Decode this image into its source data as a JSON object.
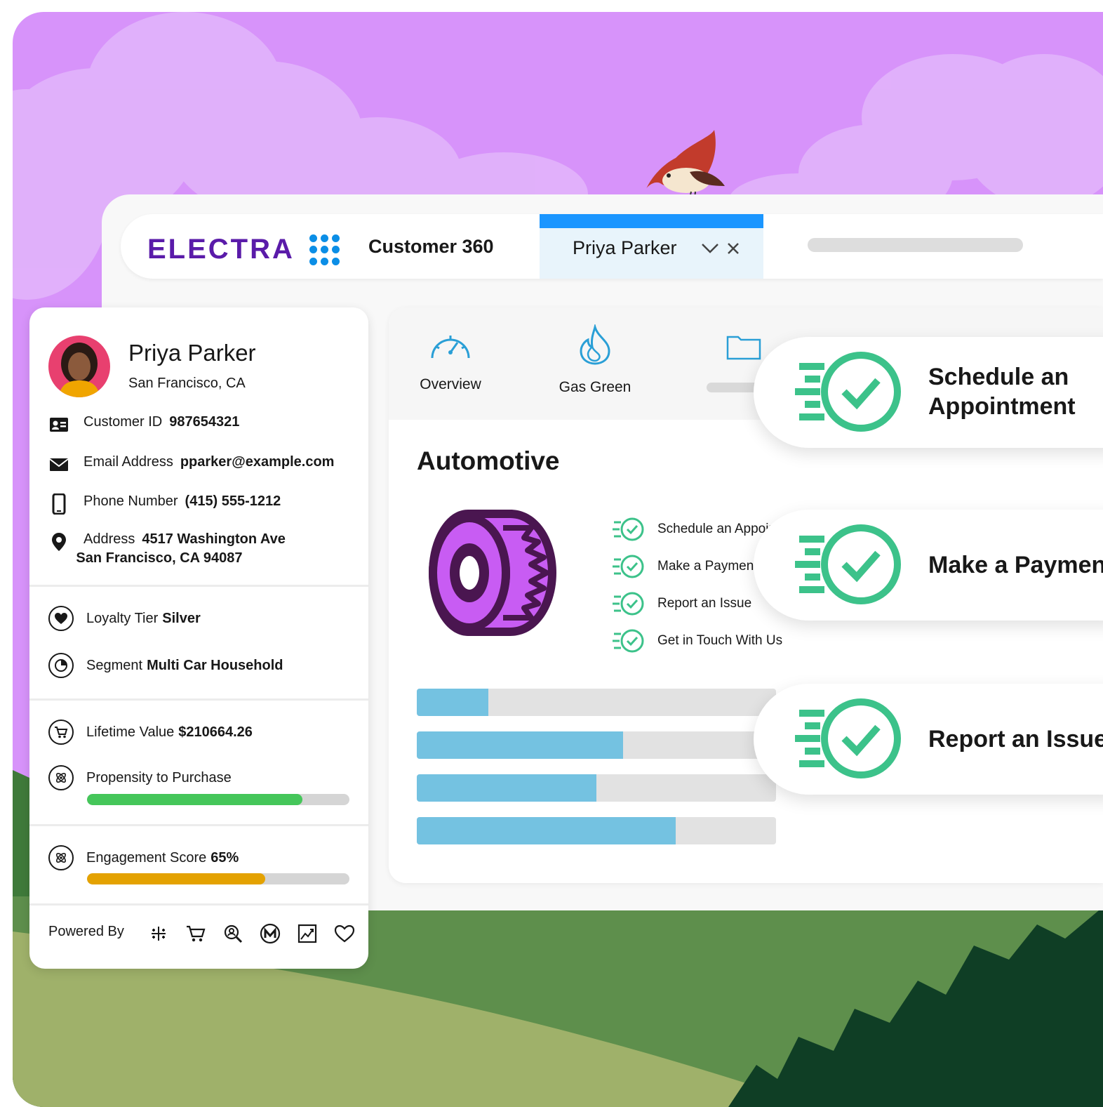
{
  "app": {
    "logo": "ELECTRA",
    "name": "Customer 360"
  },
  "tab": {
    "label": "Priya Parker",
    "accent": "#1B96FF"
  },
  "profile": {
    "name": "Priya Parker",
    "location": "San Francisco, CA",
    "fields": [
      {
        "label": "Customer ID",
        "value": "987654321",
        "icon": "id-card-icon"
      },
      {
        "label": "Email Address",
        "value": "pparker@example.com",
        "icon": "email-icon"
      },
      {
        "label": "Phone Number",
        "value": "(415) 555-1212",
        "icon": "phone-icon"
      },
      {
        "label": "Address",
        "value_line1": "4517 Washington Ave",
        "value_line2": "San Francisco, CA 94087",
        "icon": "location-pin-icon"
      }
    ],
    "loyalty": {
      "label": "Loyalty Tier",
      "value": "Silver"
    },
    "segment": {
      "label": "Segment",
      "value": "Multi Car Household"
    },
    "lifetime": {
      "label": "Lifetime Value",
      "value": "$210664.26"
    },
    "propensity": {
      "label": "Propensity to Purchase",
      "level": 0.82,
      "color": "#45C65A"
    },
    "engagement": {
      "label": "Engagement Score",
      "value": "65%",
      "level": 0.68,
      "color": "#E4A201"
    },
    "powered_by": "Powered By",
    "powered_icons": [
      "tableau-icon",
      "cart-icon",
      "search-person-icon",
      "mulesoft-icon",
      "analytics-icon",
      "heart-icon"
    ]
  },
  "subnav": {
    "items": [
      {
        "label": "Overview",
        "icon": "speedometer-icon"
      },
      {
        "label": "Gas Green",
        "icon": "flame-icon"
      },
      {
        "label": "",
        "icon": "folder-icon"
      }
    ]
  },
  "main": {
    "title": "Automotive",
    "actions": [
      "Schedule an Appointment",
      "Make a Payment",
      "Report an Issue",
      "Get in Touch With Us"
    ],
    "bars": [
      0.2,
      0.575,
      0.5,
      0.72
    ],
    "bar_color": "#74C2E1"
  },
  "pills": [
    {
      "line1": "Schedule an",
      "line2": "Appointment"
    },
    {
      "line1": "Make a Payment",
      "line2": ""
    },
    {
      "line1": "Report an Issue",
      "line2": ""
    }
  ],
  "colors": {
    "sky": "#D793FA",
    "action_green": "#3CC28A",
    "logo": "#5A1BA9"
  }
}
